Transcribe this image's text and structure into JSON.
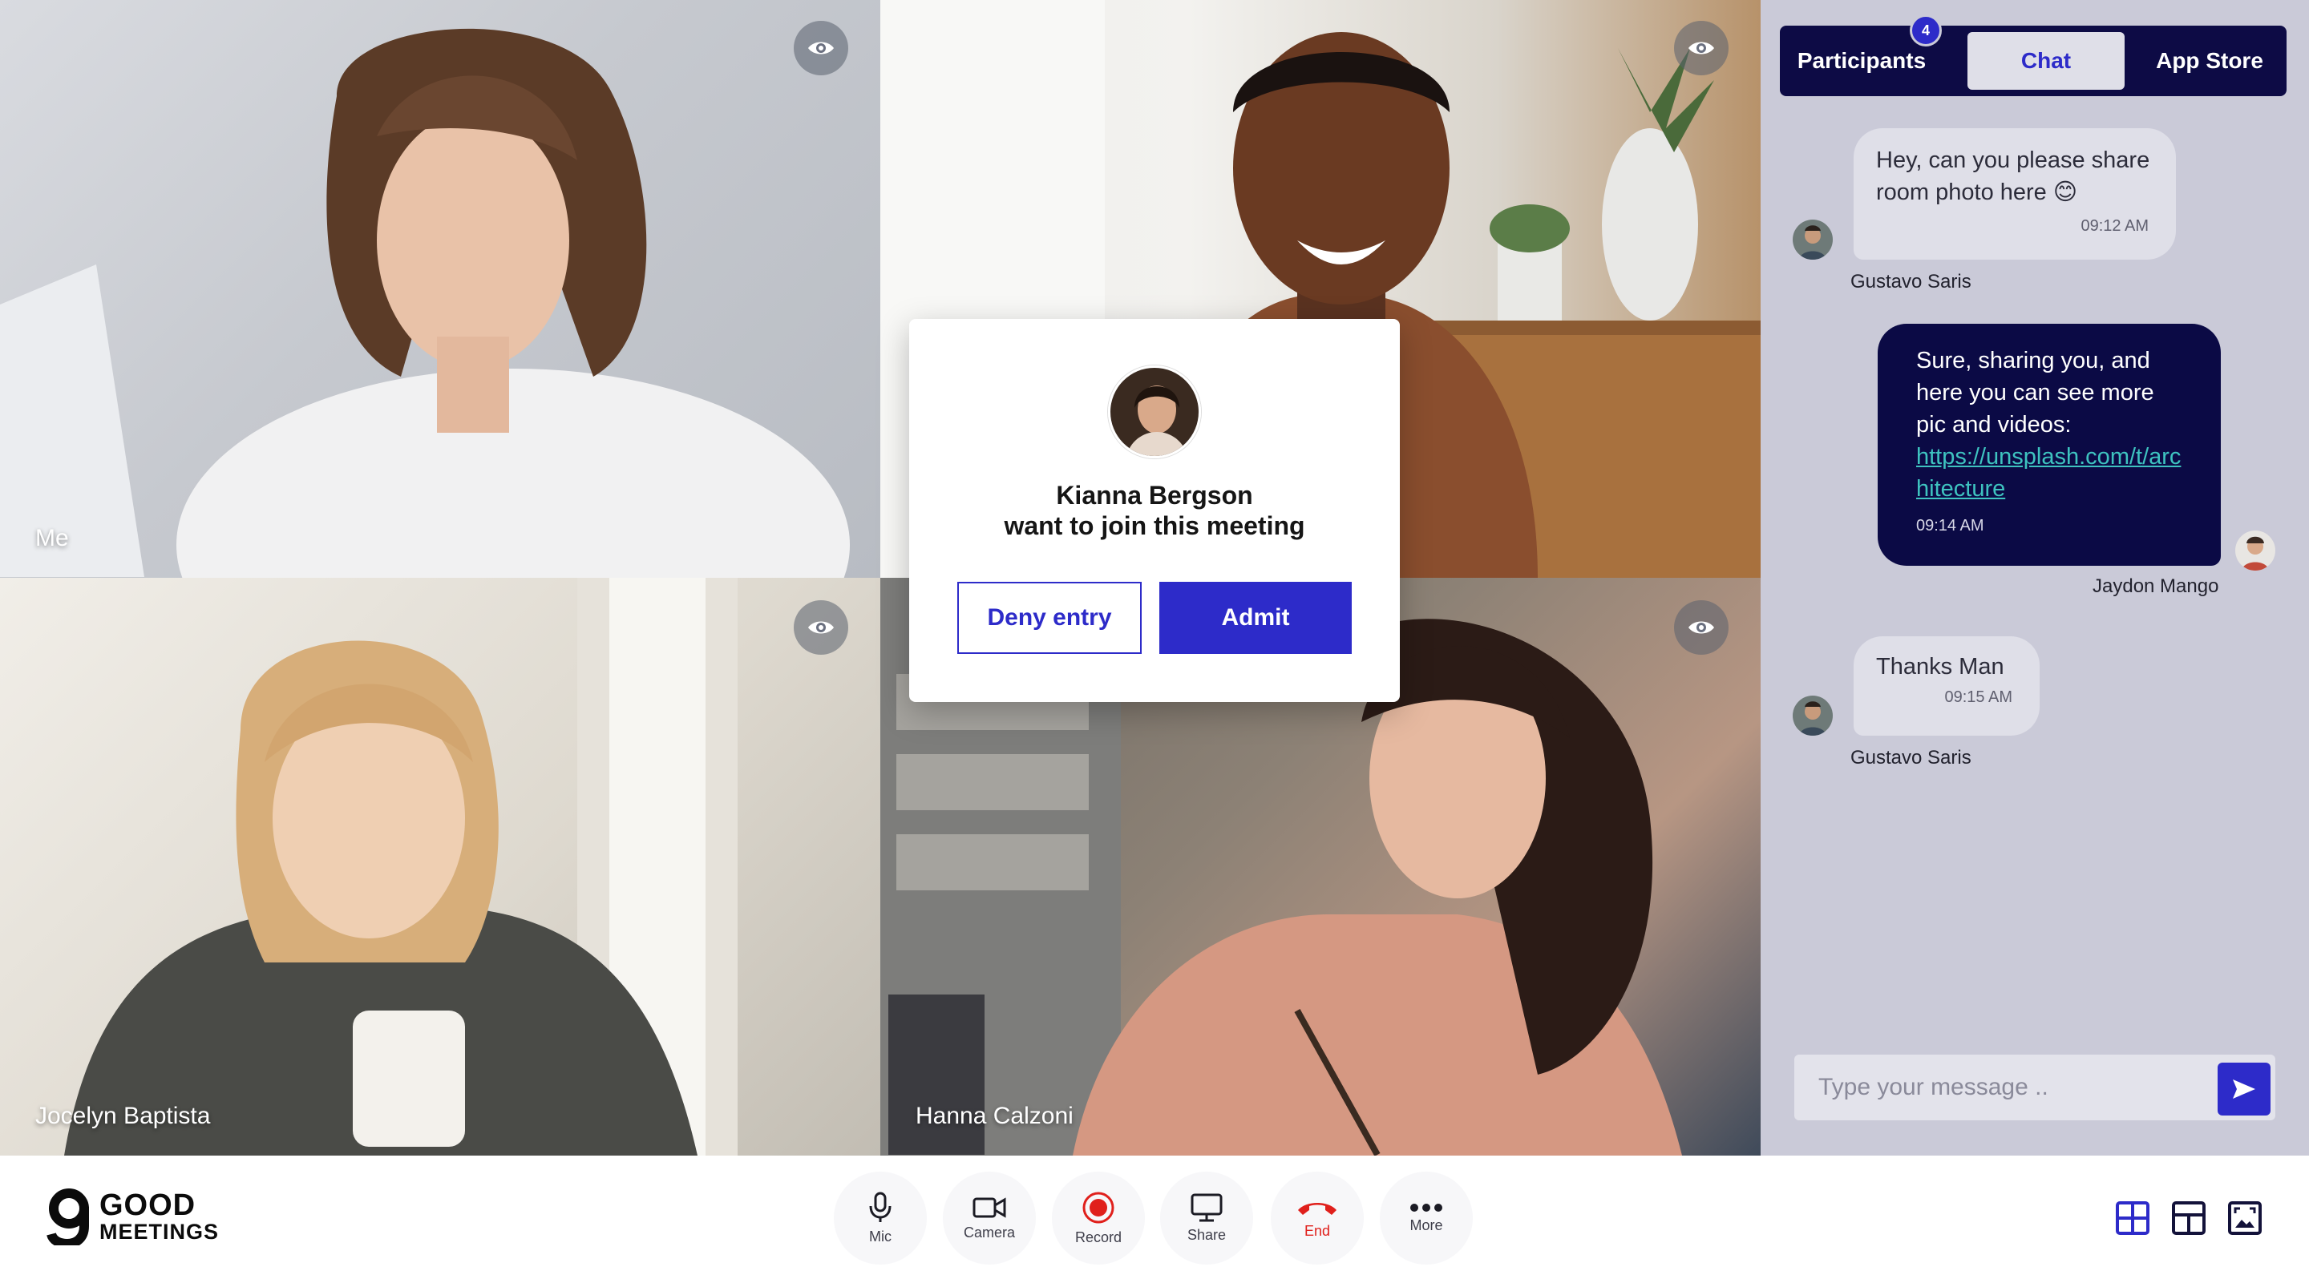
{
  "videos": [
    {
      "name": "Me"
    },
    {
      "name": ""
    },
    {
      "name": "Jocelyn Baptista"
    },
    {
      "name": "Hanna Calzoni"
    }
  ],
  "join_request": {
    "name": "Kianna Bergson",
    "message": "want to join this meeting",
    "deny_label": "Deny entry",
    "admit_label": "Admit"
  },
  "panel": {
    "tabs": {
      "participants": "Participants",
      "chat": "Chat",
      "app_store": "App Store"
    },
    "participants_count": "4"
  },
  "chat": {
    "messages": [
      {
        "sender": "Gustavo Saris",
        "text": "Hey, can you please share room photo here 😊",
        "time": "09:12 AM"
      },
      {
        "sender": "Jaydon Mango",
        "text": "Sure, sharing you, and here you can see more pic and videos:",
        "link": "https://unsplash.com/t/architecture",
        "time": "09:14 AM"
      },
      {
        "sender": "Gustavo Saris",
        "text": "Thanks Man",
        "time": "09:15 AM"
      }
    ],
    "input_placeholder": "Type your message .."
  },
  "logo": {
    "line1": "GOOD",
    "line2": "MEETINGS"
  },
  "controls": [
    {
      "label": "Mic",
      "icon": "mic-icon"
    },
    {
      "label": "Camera",
      "icon": "camera-icon"
    },
    {
      "label": "Record",
      "icon": "record-icon"
    },
    {
      "label": "Share",
      "icon": "screen-share-icon"
    },
    {
      "label": "End",
      "icon": "end-call-icon"
    },
    {
      "label": "More",
      "icon": "more-icon"
    }
  ],
  "colors": {
    "accent": "#2d2bc9",
    "navy": "#0d0b45",
    "danger": "#e0201c",
    "panel_bg": "#cacad8"
  }
}
